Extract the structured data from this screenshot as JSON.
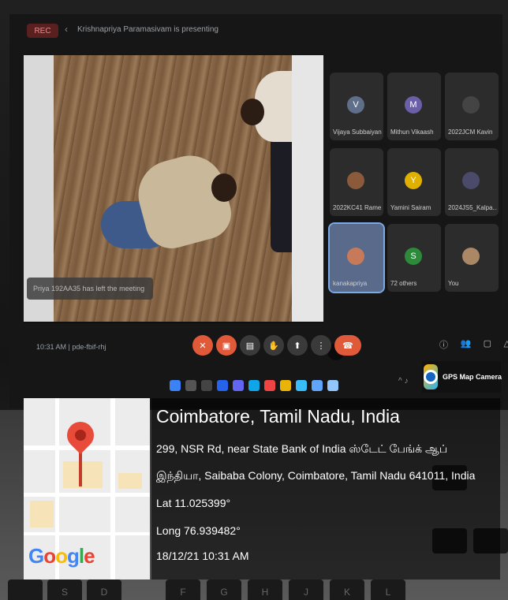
{
  "meet": {
    "rec_label": "REC",
    "presenting_text": "Krishnapriya Paramasivam is presenting",
    "left_notice": "Priya 192AA35 has left the meeting",
    "time_code": "10:31 AM  |  pde-fbif-rhj",
    "participants": [
      {
        "name": "Vijaya Subbaiyan",
        "initial": "V",
        "color": "#5f6f8a"
      },
      {
        "name": "Mithun Vikaash",
        "initial": "M",
        "color": "#6b5fa8"
      },
      {
        "name": "2022JCM Kavin",
        "initial": "",
        "color": "#444"
      },
      {
        "name": "2022KC41 Rame...",
        "initial": "",
        "color": "#8a5a3a"
      },
      {
        "name": "Yamini Sairam",
        "initial": "Y",
        "color": "#e0b000"
      },
      {
        "name": "2024JS5_Kalpa...",
        "initial": "",
        "color": "#4a4a6a"
      },
      {
        "name": "kanakapriya",
        "initial": "",
        "color": "#c77a5a"
      },
      {
        "name": "72 others",
        "initial": "S",
        "color": "#2d8a3a"
      },
      {
        "name": "You",
        "initial": "",
        "color": "#aa8866"
      }
    ],
    "controls": [
      "mic-off",
      "cam-off",
      "captions",
      "raise-hand",
      "present",
      "more",
      "end-call"
    ]
  },
  "gps_camera": {
    "label": "GPS Map Camera"
  },
  "location": {
    "city": "Coimbatore, Tamil Nadu, India",
    "address_line1": "299, NSR Rd, near State Bank of India ஸ்டேட் பேங்க் ஆப்",
    "address_line2": "இந்தியா, Saibaba Colony, Coimbatore, Tamil Nadu 641011, India",
    "lat": "Lat 11.025399°",
    "long": "Long 76.939482°",
    "datetime": "18/12/21 10:31 AM",
    "map_brand": "Google"
  },
  "keyboard_keys": [
    "F",
    "G",
    "H",
    "J",
    "K",
    "L",
    "S",
    "D"
  ]
}
